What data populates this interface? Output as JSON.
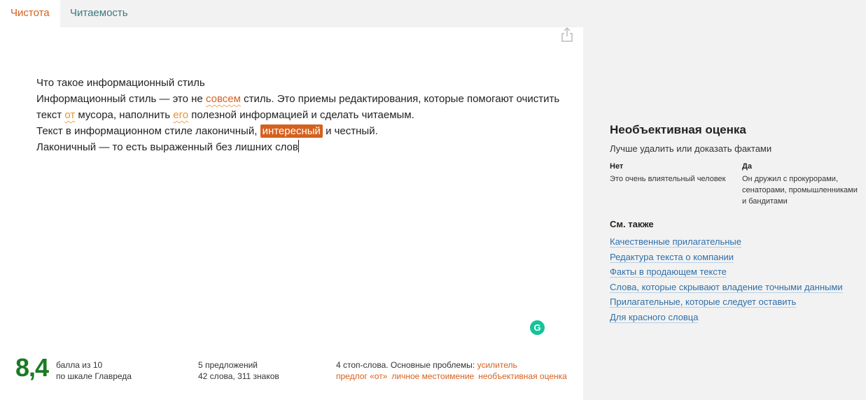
{
  "tabs": [
    {
      "label": "Чистота",
      "active": true
    },
    {
      "label": "Читаемость",
      "active": false
    }
  ],
  "editor": {
    "line1": "Что такое информационный стиль",
    "line2": {
      "p1": "Информационный стиль — это не ",
      "h1": "совсем",
      "p2": " стиль. Это приемы редактирования, которые помогают очистить"
    },
    "line3": {
      "p1": "текст ",
      "h1": "от",
      "p2": " мусора, наполнить ",
      "h2": "его",
      "p3": " полезной информацией и сделать читаемым."
    },
    "line4": {
      "p1": "Текст в информационном стиле лаконичный, ",
      "selected": "интересный",
      "p2": " и честный."
    },
    "line5": "Лаконичный — то есть выраженный без лишних слов"
  },
  "score": {
    "value": "8,4",
    "label_line1": "балла из 10",
    "label_line2": "по шкале Главреда"
  },
  "stats": {
    "sentences": "5 предложений",
    "words_chars": "42 слова, 311 знаков"
  },
  "problems": {
    "prefix": "4 стоп-слова. Основные проблемы: ",
    "items": [
      "усилитель",
      "предлог «от»",
      "личное местоимение",
      "необъективная оценка"
    ]
  },
  "panel": {
    "title": "Необъективная оценка",
    "subtitle": "Лучше удалить или доказать фактами",
    "no_label": "Нет",
    "no_example": "Это очень влиятельный человек",
    "yes_label": "Да",
    "yes_example_1": "Он дружил с прокурорами,",
    "yes_example_2": "сенаторами, промышленниками",
    "yes_example_3": "и бандитами",
    "see_also": "См. также",
    "links": [
      "Качественные прилагательные",
      "Редактура текста о компании",
      "Факты в продающем тексте",
      "Слова, которые скрывают владение точными данными",
      "Прилагательные, которые следует оставить",
      "Для красного словца"
    ]
  },
  "icons": {
    "share": "share-icon",
    "grammarly": "grammarly-icon"
  },
  "colors": {
    "accent": "#d4611e",
    "score": "#1b7a23",
    "link": "#2f6fa8",
    "grammarly": "#15c39a"
  }
}
